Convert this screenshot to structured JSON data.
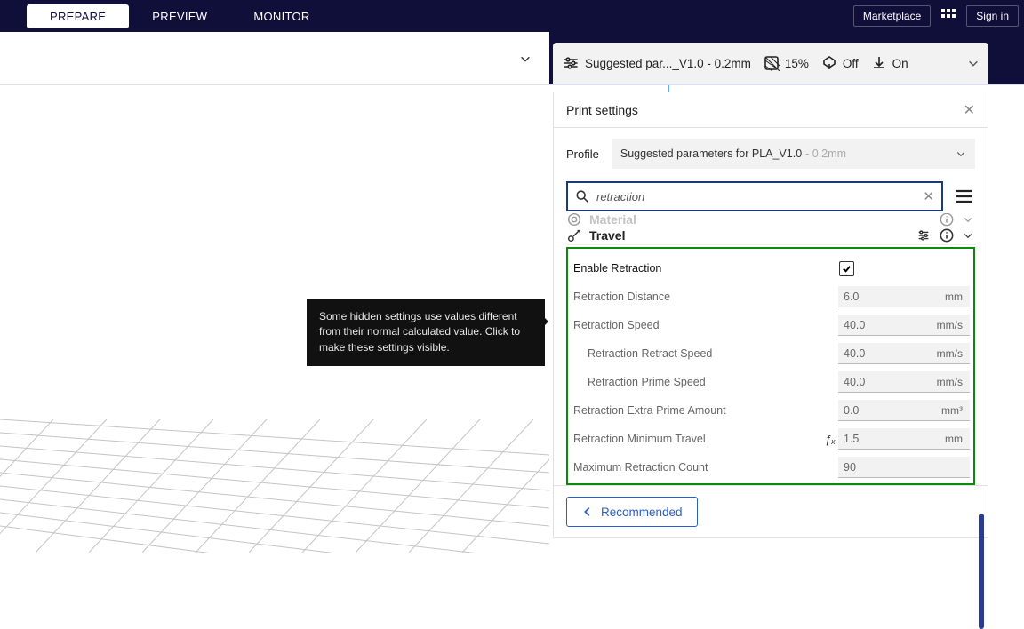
{
  "topbar": {
    "tabs": {
      "prepare": "PREPARE",
      "preview": "PREVIEW",
      "monitor": "MONITOR"
    },
    "marketplace": "Marketplace",
    "signin": "Sign in"
  },
  "summary": {
    "profile_short": "Suggested par..._V1.0 - 0.2mm",
    "infill": "15%",
    "support": "Off",
    "adhesion": "On"
  },
  "tooltip": "Some hidden settings use values different from their normal calculated value. Click to make these settings visible.",
  "panel": {
    "title": "Print settings",
    "profile_label": "Profile",
    "profile_name": "Suggested parameters for PLA_V1.0",
    "profile_suffix": " - 0.2mm",
    "search_value": "retraction",
    "cat_material": "Material",
    "cat_travel": "Travel",
    "settings": {
      "enable": {
        "label": "Enable Retraction"
      },
      "distance": {
        "label": "Retraction Distance",
        "value": "6.0",
        "unit": "mm"
      },
      "speed": {
        "label": "Retraction Speed",
        "value": "40.0",
        "unit": "mm/s"
      },
      "retract_speed": {
        "label": "Retraction Retract Speed",
        "value": "40.0",
        "unit": "mm/s"
      },
      "prime_speed": {
        "label": "Retraction Prime Speed",
        "value": "40.0",
        "unit": "mm/s"
      },
      "extra_prime": {
        "label": "Retraction Extra Prime Amount",
        "value": "0.0",
        "unit": "mm³"
      },
      "min_travel": {
        "label": "Retraction Minimum Travel",
        "value": "1.5",
        "unit": "mm",
        "fx": "ƒₓ"
      },
      "max_count": {
        "label": "Maximum Retraction Count",
        "value": "90",
        "unit": ""
      }
    },
    "recommended": "Recommended"
  }
}
